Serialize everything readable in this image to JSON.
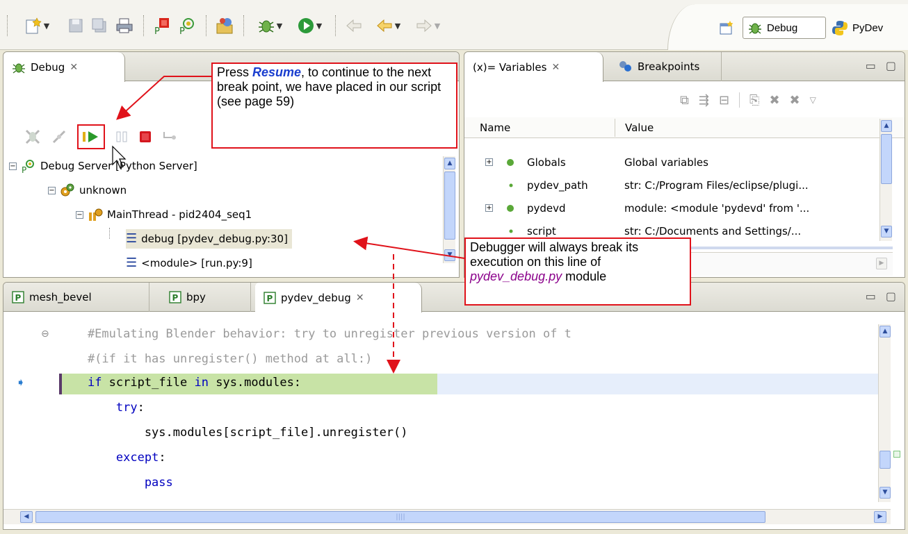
{
  "toolbar": {
    "icons": [
      "new-wizard-icon",
      "save-icon",
      "save-all-icon",
      "print-icon",
      "pydev-module-icon",
      "pydev-project-icon",
      "open-type-icon",
      "debug-icon",
      "run-icon",
      "back-icon",
      "prev-edit-icon",
      "forward-icon"
    ],
    "perspectives": [
      {
        "label": "Debug",
        "active": true
      },
      {
        "label": "PyDev",
        "active": false
      }
    ]
  },
  "debug_view": {
    "tab_label": "Debug",
    "tree": [
      {
        "label": "Debug Server [Python Server]",
        "level": 0
      },
      {
        "label": "unknown",
        "level": 1
      },
      {
        "label": "MainThread - pid2404_seq1",
        "level": 2
      },
      {
        "label": "debug [pydev_debug.py:30]",
        "level": 3,
        "selected": true
      },
      {
        "label": "<module> [run.py:9]",
        "level": 3
      }
    ]
  },
  "variables_view": {
    "tabs": [
      "(x)= Variables",
      "Breakpoints"
    ],
    "headers": {
      "name": "Name",
      "value": "Value"
    },
    "rows": [
      {
        "name": "Globals",
        "value": "Global variables",
        "expandable": true
      },
      {
        "name": "pydev_path",
        "value": "str: C:/Program Files/eclipse/plugi...",
        "expandable": false
      },
      {
        "name": "pydevd",
        "value": "module: <module 'pydevd' from '...",
        "expandable": true
      },
      {
        "name": "script",
        "value": "str: C:/Documents and Settings/...",
        "expandable": false
      }
    ]
  },
  "editor": {
    "tabs": [
      "mesh_bevel",
      "bpy",
      "pydev_debug"
    ],
    "active_tab": "pydev_debug",
    "lines": [
      "    #Emulating Blender behavior: try to unregister previous version of t",
      "    #(if it has unregister() method at all:)",
      "    if script_file in sys.modules:",
      "        try:",
      "            sys.modules[script_file].unregister()",
      "        except:",
      "            pass"
    ],
    "current_line": 3
  },
  "callouts": {
    "resume": {
      "prefix": "Press ",
      "keyword": "Resume",
      "rest": ", to continue to the next break point, we have placed in our script (see page 59)"
    },
    "debugger": {
      "text": "Debugger will always break its execution on this line of ",
      "module": "pydev_debug.py",
      "suffix": " module"
    }
  },
  "colors": {
    "callout_border": "#e0121a",
    "keyword": "#0000c0",
    "comment": "#9a9a9a",
    "current_line_bg": "#c8e3a6",
    "highlight_line_bg": "#e6eefb",
    "resume_text": "#1a3ecf",
    "module_text": "#8b008b"
  }
}
